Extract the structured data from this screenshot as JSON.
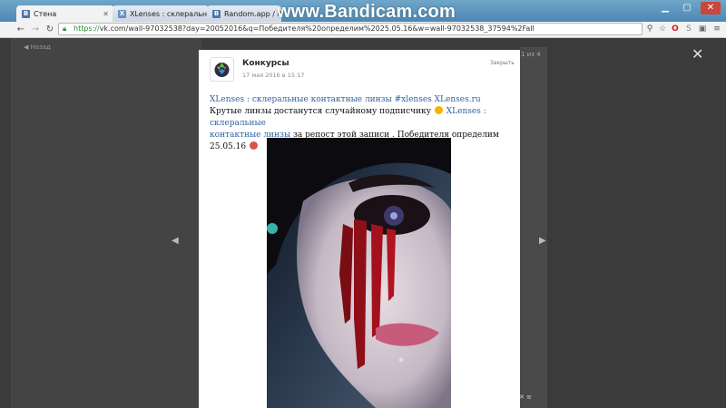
{
  "watermark": "www.Bandicam.com",
  "browser": {
    "tabs": [
      {
        "label": "Стена",
        "favicon": "В"
      },
      {
        "label": "XLenses : склеральные к",
        "favicon": "X"
      },
      {
        "label": "Random.app / Розыгр",
        "favicon": "В"
      }
    ],
    "url": {
      "scheme": "https://",
      "rest": "vk.com/wall-97032538?day=20052016&q=Победителя%20определим%2025.05.16&w=wall-97032538_37594%2Fall"
    }
  },
  "page": {
    "back_link": "◀ Назад",
    "counter": "1 из 4"
  },
  "post": {
    "author": "Конкурсы",
    "date": "17 мая 2016 в 15:17",
    "close_label": "Закрыть",
    "line1_link": "XLenses : склеральные контактные линзы #xlenses XLenses.ru",
    "line2_text": "Крутые линзы достанутся случайному подписчику",
    "line2_link": "XLenses : склеральные",
    "line3_link": "контактные линзы",
    "line3_text": "за репост этой записи . Победителя определим 25.05.16"
  },
  "colors": {
    "accent_link": "#2f64a0",
    "titlebar": "#5b94bd",
    "overlay": "#3b3b3b"
  }
}
